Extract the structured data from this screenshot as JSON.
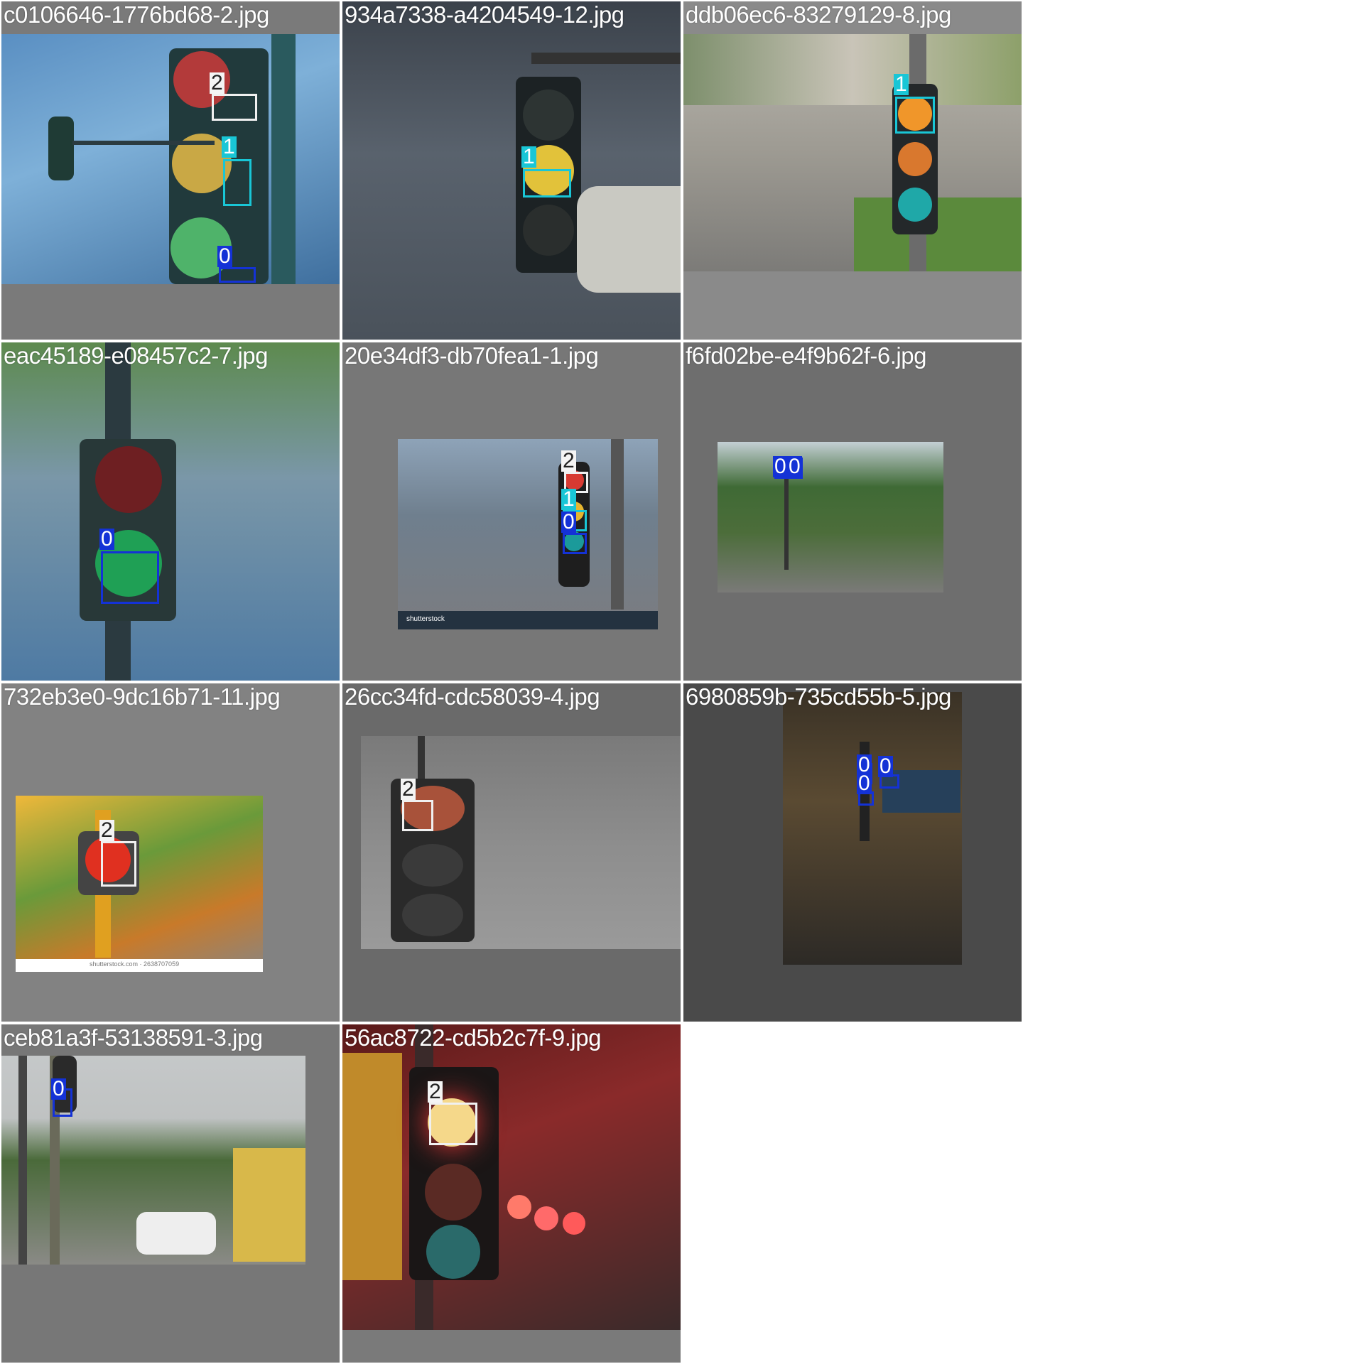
{
  "tiles": [
    {
      "filename": "c0106646-1776bd68-2.jpg",
      "labels": [
        "2",
        "1",
        "0"
      ]
    },
    {
      "filename": "934a7338-a4204549-12.jpg",
      "labels": [
        "1"
      ]
    },
    {
      "filename": "ddb06ec6-83279129-8.jpg",
      "labels": [
        "1"
      ]
    },
    {
      "filename": "eac45189-e08457c2-7.jpg",
      "labels": [
        "0"
      ]
    },
    {
      "filename": "20e34df3-db70fea1-1.jpg",
      "labels": [
        "2",
        "1",
        "0"
      ]
    },
    {
      "filename": "f6fd02be-e4f9b62f-6.jpg",
      "labels": [
        "0",
        "0"
      ]
    },
    {
      "filename": "732eb3e0-9dc16b71-11.jpg",
      "labels": [
        "2"
      ]
    },
    {
      "filename": "26cc34fd-cdc58039-4.jpg",
      "labels": [
        "2"
      ]
    },
    {
      "filename": "6980859b-735cd55b-5.jpg",
      "labels": [
        "0",
        "0",
        "0"
      ]
    },
    {
      "filename": "ceb81a3f-53138591-3.jpg",
      "labels": [
        "0"
      ]
    },
    {
      "filename": "56ac8722-cd5b2c7f-9.jpg",
      "labels": [
        "2"
      ]
    }
  ],
  "watermarks": {
    "shutterstock": "shutterstock",
    "shutterstock_id": "shutterstock.com · 2638707059"
  },
  "colors": {
    "class0": "#1432d6",
    "class1": "#19c6d6",
    "class2": "#f0f0f0"
  }
}
